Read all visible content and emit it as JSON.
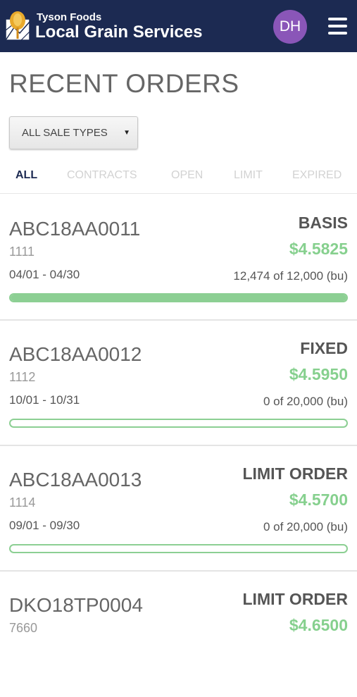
{
  "header": {
    "brand_top": "Tyson Foods",
    "brand_main": "Local Grain Services",
    "avatar_initials": "DH",
    "avatar_color": "#8a56b8",
    "background": "#1c2a52"
  },
  "page": {
    "title": "RECENT ORDERS"
  },
  "filter": {
    "selected": "ALL SALE TYPES"
  },
  "tabs": [
    {
      "label": "ALL",
      "active": true
    },
    {
      "label": "CONTRACTS",
      "active": false
    },
    {
      "label": "OPEN",
      "active": false
    },
    {
      "label": "LIMIT",
      "active": false
    },
    {
      "label": "EXPIRED",
      "active": false
    }
  ],
  "orders": [
    {
      "id": "ABC18AA0011",
      "number": "1111",
      "dates": "04/01 - 04/30",
      "type": "BASIS",
      "price": "$4.5825",
      "quantity": "12,474 of 12,000 (bu)",
      "progress": 1.0
    },
    {
      "id": "ABC18AA0012",
      "number": "1112",
      "dates": "10/01 - 10/31",
      "type": "FIXED",
      "price": "$4.5950",
      "quantity": "0 of 20,000 (bu)",
      "progress": 0
    },
    {
      "id": "ABC18AA0013",
      "number": "1114",
      "dates": "09/01 - 09/30",
      "type": "LIMIT ORDER",
      "price": "$4.5700",
      "quantity": "0 of 20,000 (bu)",
      "progress": 0
    },
    {
      "id": "DKO18TP0004",
      "number": "7660",
      "dates": "",
      "type": "LIMIT ORDER",
      "price": "$4.6500",
      "quantity": "",
      "progress": 0
    }
  ],
  "colors": {
    "accent_green": "#86d08e",
    "progress_green": "#8ccf93",
    "tab_active": "#1c2a52"
  }
}
